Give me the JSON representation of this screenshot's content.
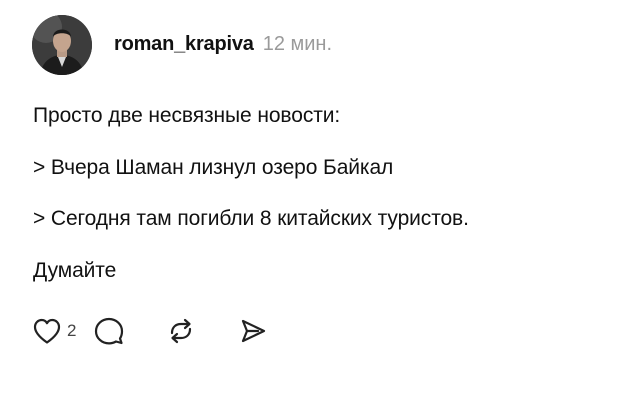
{
  "post": {
    "author": {
      "username": "roman_krapiva",
      "time": "12 мин."
    },
    "content": {
      "lines": [
        "Просто две несвязные новости:",
        "> Вчера Шаман лизнул озеро Байкал",
        "> Сегодня там погибли 8 китайских туристов.",
        "Думайте"
      ]
    },
    "actions": {
      "like_count": "2",
      "icons": [
        "heart-icon",
        "comment-icon",
        "repost-icon",
        "share-icon"
      ]
    }
  }
}
